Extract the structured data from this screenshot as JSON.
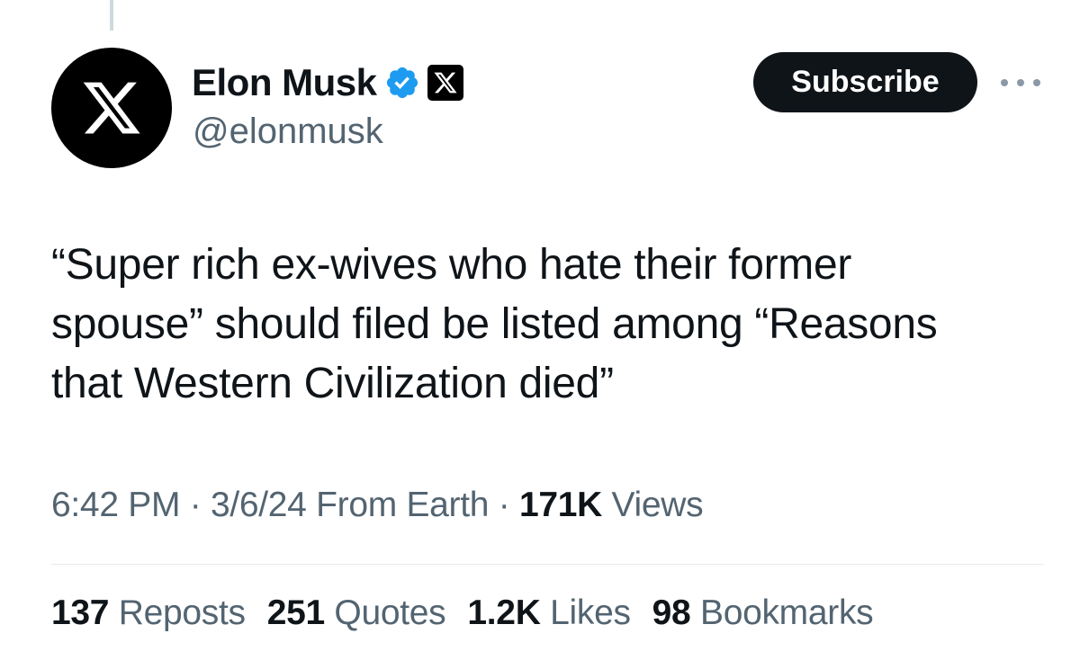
{
  "author": {
    "display_name": "Elon Musk",
    "handle": "@elonmusk",
    "avatar_icon": "x-logo-icon",
    "verified_icon": "verified-badge-icon",
    "affiliate_icon": "x-affiliate-badge-icon",
    "verified_color": "#1d9bf0"
  },
  "actions": {
    "subscribe_label": "Subscribe",
    "more_icon": "more-options-icon"
  },
  "tweet": {
    "lines": [
      "“Super rich ex-wives who hate their former",
      "spouse” should filed be listed among “Reasons",
      "that Western Civilization died”"
    ]
  },
  "meta": {
    "time": "6:42 PM",
    "separator": "·",
    "date": "3/6/24",
    "source": "From Earth",
    "views_count": "171K",
    "views_label": "Views"
  },
  "stats": [
    {
      "count": "137",
      "label": "Reposts"
    },
    {
      "count": "251",
      "label": "Quotes"
    },
    {
      "count": "1.2K",
      "label": "Likes"
    },
    {
      "count": "98",
      "label": "Bookmarks"
    }
  ]
}
